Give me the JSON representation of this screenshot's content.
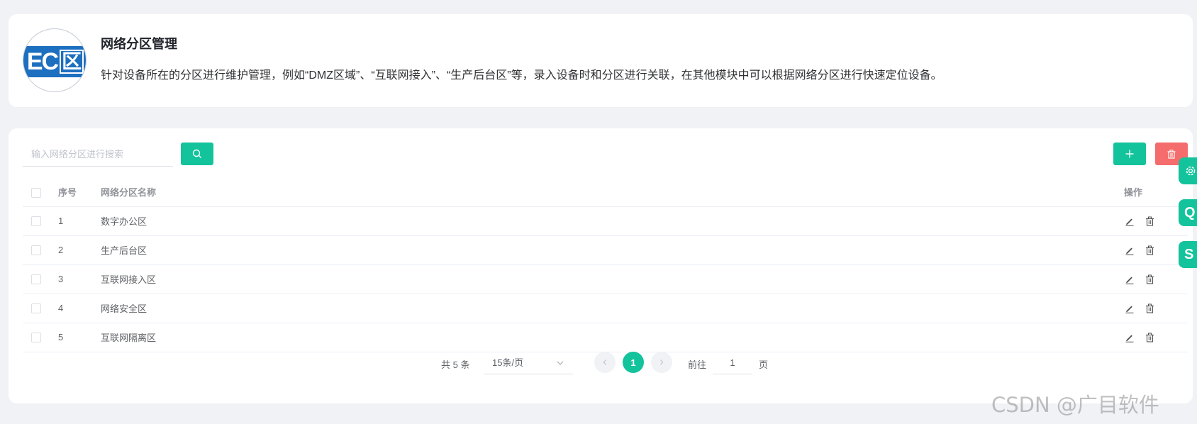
{
  "header": {
    "logo_text": "EC区",
    "title": "网络分区管理",
    "description": "针对设备所在的分区进行维护管理，例如“DMZ区域”、“互联网接入”、“生产后台区”等，录入设备时和分区进行关联，在其他模块中可以根据网络分区进行快速定位设备。"
  },
  "toolbar": {
    "search_placeholder": "输入网络分区进行搜索",
    "search_value": "",
    "search_icon": "search-icon",
    "add_icon": "plus-icon",
    "delete_icon": "trash-icon"
  },
  "table": {
    "headers": {
      "index": "序号",
      "name": "网络分区名称",
      "actions": "操作"
    },
    "rows": [
      {
        "index": "1",
        "name": "数字办公区"
      },
      {
        "index": "2",
        "name": "生产后台区"
      },
      {
        "index": "3",
        "name": "互联网接入区"
      },
      {
        "index": "4",
        "name": "网络安全区"
      },
      {
        "index": "5",
        "name": "互联网隔离区"
      }
    ]
  },
  "pagination": {
    "total": "共 5 条",
    "page_size": "15条/页",
    "current_page": "1",
    "goto_label": "前往",
    "goto_value": "1",
    "goto_suffix": "页"
  },
  "side_buttons": [
    "",
    "Q",
    "S"
  ],
  "colors": {
    "primary": "#13c39c",
    "danger": "#f56c6c",
    "background": "#f0f2f5"
  },
  "watermark": "CSDN @广目软件"
}
